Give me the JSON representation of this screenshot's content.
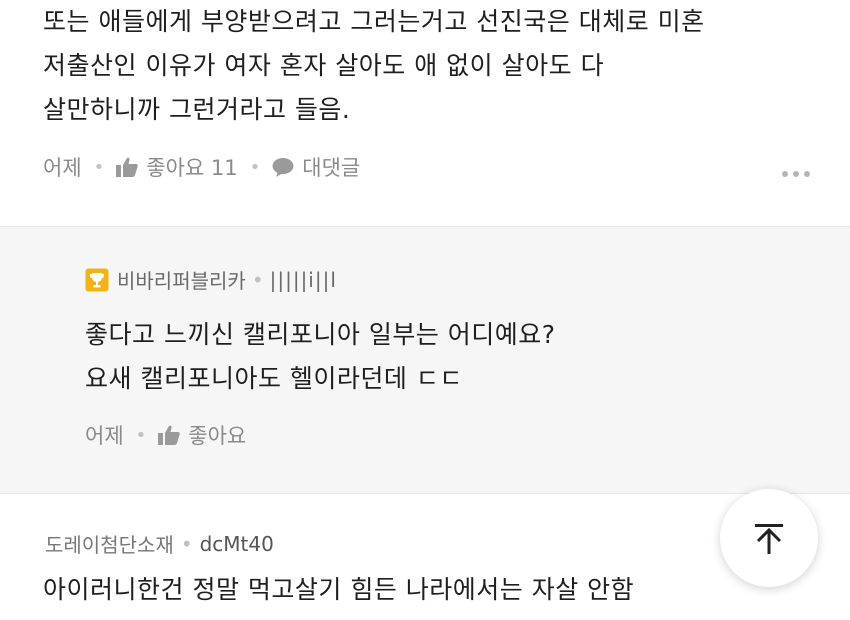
{
  "comment1": {
    "lines": [
      "또는 애들에게 부양받으려고 그러는거고 선진국은 대체로 미혼",
      "저출산인 이유가 여자 혼자 살아도 애 없이 살아도 다",
      "살만하니까 그런거라고 들음."
    ],
    "time": "어제",
    "like_label": "좋아요 11",
    "reply_label": "대댓글"
  },
  "reply": {
    "author": "비바리퍼블리카",
    "user_id": "|||||i||l",
    "lines": [
      "좋다고 느끼신 캘리포니아 일부는 어디예요?",
      "요새 캘리포니아도 헬이라던데 ㄷㄷ"
    ],
    "time": "어제",
    "like_label": "좋아요"
  },
  "comment3": {
    "author": "도레이첨단소재",
    "user_id": "dcMt40",
    "text": "아이러니한건 정말 먹고살기 힘든 나라에서는 자살 안함"
  },
  "colors": {
    "reply_bg": "#f6f6f6",
    "trophy": "#f2b318",
    "meta_text": "#8a8a8a"
  },
  "icons": {
    "like": "thumbs-up-icon",
    "reply": "speech-bubble-icon",
    "more": "more-dots-icon",
    "badge": "trophy-icon",
    "scroll_top": "arrow-up-to-top-icon"
  }
}
